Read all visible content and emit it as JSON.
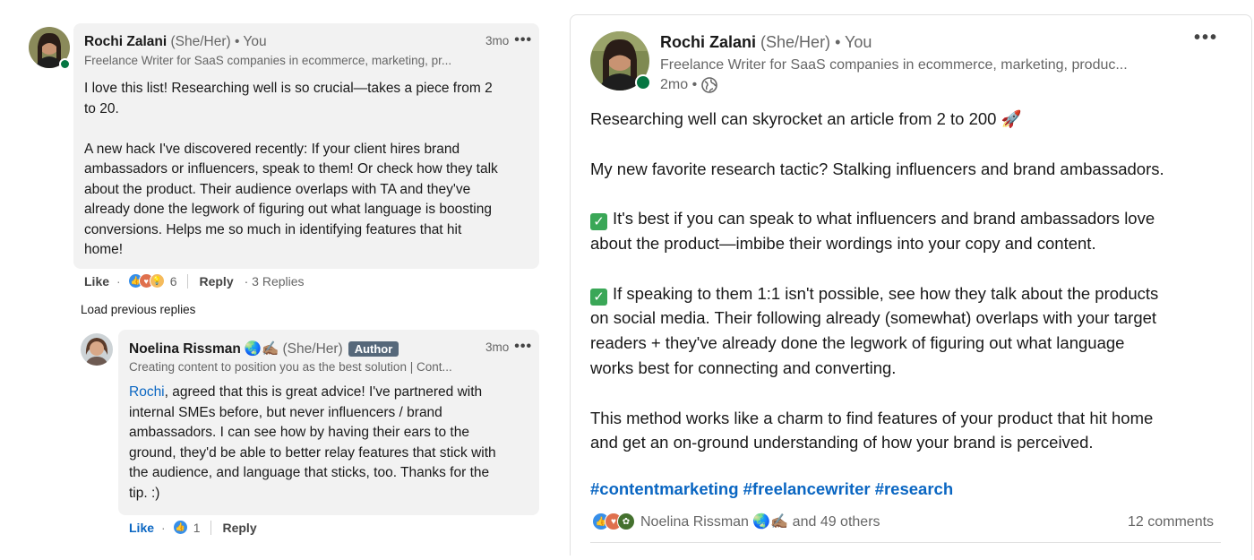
{
  "comment": {
    "author_name": "Rochi Zalani",
    "pronouns": "(She/Her)",
    "relation": "• You",
    "headline": "Freelance Writer for SaaS companies in ecommerce, marketing, pr...",
    "time": "3mo",
    "more_icon": "•••",
    "body_lines": [
      "I love this list! Researching well is so crucial—takes a piece from 2",
      "to 20.",
      "",
      "A new hack I've discovered recently: If your client hires brand",
      "ambassadors or influencers, speak to them! Or check how they talk",
      "about the product. Their audience overlaps with TA and they've",
      "already done the legwork of figuring out what language is boosting",
      "conversions. Helps me so much in identifying features that hit",
      "home!"
    ],
    "like_label": "Like",
    "reaction_count": "6",
    "reply_label": "Reply",
    "replies_label": "· 3 Replies",
    "load_previous": "Load previous replies"
  },
  "reply": {
    "author_name": "Noelina Rissman",
    "emoji": "🌏✍🏽",
    "pronouns": "(She/Her)",
    "badge": "Author",
    "headline": "Creating content to position you as the best solution | Cont...",
    "time": "3mo",
    "more_icon": "•••",
    "mention": "Rochi",
    "body_first": ", agreed that this is great advice! I've partnered with",
    "body_lines": [
      "internal SMEs before, but never influencers / brand",
      "ambassadors. I can see how by having their ears to the",
      "ground, they'd be able to better relay features that stick with",
      "the audience, and language that sticks, too. Thanks for the",
      "tip. :)"
    ],
    "like_label": "Like",
    "reaction_count": "1",
    "reply_label": "Reply"
  },
  "post": {
    "author_name": "Rochi Zalani",
    "pronouns": "(She/Her)",
    "relation": "• You",
    "headline": "Freelance Writer for SaaS companies in ecommerce, marketing, produc...",
    "time": "2mo •",
    "more_icon": "•••",
    "p1": "Researching well can skyrocket an article from 2 to 200 🚀",
    "p2": "My new favorite research tactic? Stalking influencers and brand ambassadors.",
    "p3_lines": [
      "It's best if you can speak to what influencers and brand ambassadors love",
      "about the product—imbibe their wordings into your copy and content."
    ],
    "p4_lines": [
      "If speaking to them 1:1 isn't possible, see how they talk about the products",
      "on social media. Their following already (somewhat) overlaps with your target",
      "readers + they've already done the legwork of figuring out what language",
      "works best for connecting and converting."
    ],
    "p5_lines": [
      "This method works like a charm to find features of your product that hit home",
      "and get an on-ground understanding of how your brand is perceived."
    ],
    "hashtags": "#contentmarketing #freelancewriter #research",
    "social_text": "Noelina Rissman 🌏✍🏽 and 49 others",
    "comments_count": "12 comments"
  },
  "colors": {
    "link_blue": "#0a66c2",
    "online_green": "#057642",
    "bubble_gray": "#f2f2f2",
    "badge_gray": "#56687a"
  },
  "icons": {
    "reactions": [
      "like-icon",
      "love-icon",
      "insightful-icon"
    ],
    "globe": "globe-icon",
    "check": "check-mark-icon"
  }
}
